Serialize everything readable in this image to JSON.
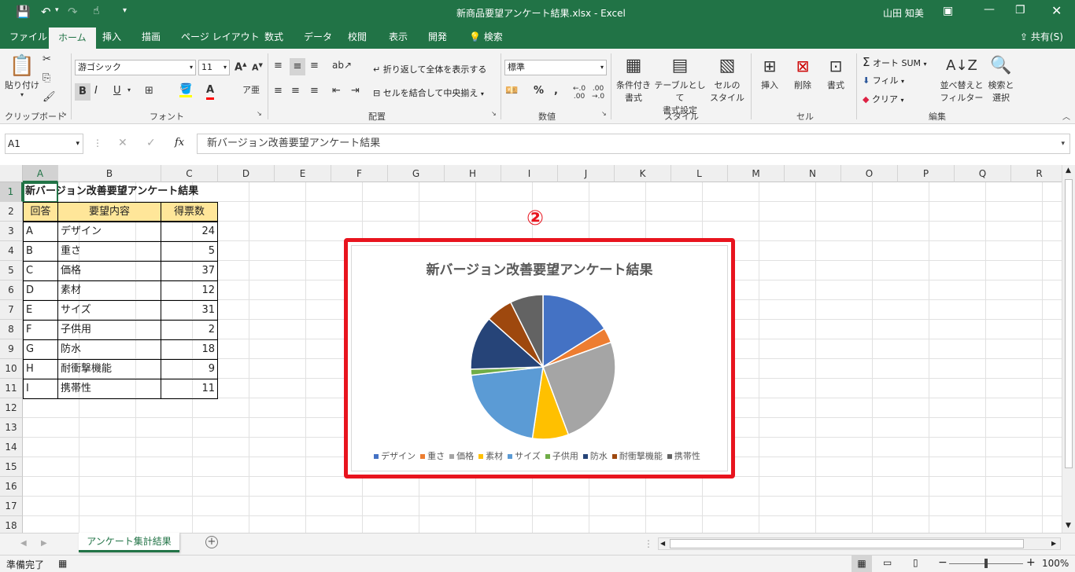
{
  "window": {
    "title": "新商品要望アンケート結果.xlsx  -  Excel",
    "user": "山田 知美"
  },
  "tabs": [
    "ファイル",
    "ホーム",
    "挿入",
    "描画",
    "ページ レイアウト",
    "数式",
    "データ",
    "校閲",
    "表示",
    "開発"
  ],
  "tell_me": "検索",
  "share": "共有(S)",
  "ribbon": {
    "clipboard": {
      "paste": "貼り付け",
      "group": "クリップボード"
    },
    "font": {
      "name": "游ゴシック",
      "size": "11",
      "group": "フォント"
    },
    "alignment": {
      "wrap": "折り返して全体を表示する",
      "merge": "セルを結合して中央揃え",
      "group": "配置"
    },
    "number": {
      "format": "標準",
      "group": "数値"
    },
    "styles": {
      "cond_line1": "条件付き",
      "cond_line2": "書式",
      "table_line1": "テーブルとして",
      "table_line2": "書式設定",
      "cell_line1": "セルの",
      "cell_line2": "スタイル",
      "group": "スタイル"
    },
    "cells": {
      "insert": "挿入",
      "delete": "削除",
      "format": "書式",
      "group": "セル"
    },
    "editing": {
      "autosum": "オート SUM",
      "fill": "フィル",
      "clear": "クリア",
      "sort_line1": "並べ替えと",
      "sort_line2": "フィルター",
      "find_line1": "検索と",
      "find_line2": "選択",
      "group": "編集"
    }
  },
  "formula_bar": {
    "name_box": "A1",
    "fx": "fx",
    "content": "新バージョン改善要望アンケート結果"
  },
  "columns": [
    "A",
    "B",
    "C",
    "D",
    "E",
    "F",
    "G",
    "H",
    "I",
    "J",
    "K",
    "L",
    "M",
    "N",
    "O",
    "P",
    "Q",
    "R"
  ],
  "rows": [
    "1",
    "2",
    "3",
    "4",
    "5",
    "6",
    "7",
    "8",
    "9",
    "10",
    "11",
    "12",
    "13",
    "14",
    "15",
    "16",
    "17",
    "18"
  ],
  "sheet": {
    "title": "新バージョン改善要望アンケート結果",
    "headers": [
      "回答",
      "要望内容",
      "得票数"
    ],
    "data": [
      [
        "A",
        "デザイン",
        "24"
      ],
      [
        "B",
        "重さ",
        "5"
      ],
      [
        "C",
        "価格",
        "37"
      ],
      [
        "D",
        "素材",
        "12"
      ],
      [
        "E",
        "サイズ",
        "31"
      ],
      [
        "F",
        "子供用",
        "2"
      ],
      [
        "G",
        "防水",
        "18"
      ],
      [
        "H",
        "耐衝撃機能",
        "9"
      ],
      [
        "I",
        "携帯性",
        "11"
      ]
    ]
  },
  "annotation": "②",
  "chart_data": {
    "type": "pie",
    "title": "新バージョン改善要望アンケート結果",
    "categories": [
      "デザイン",
      "重さ",
      "価格",
      "素材",
      "サイズ",
      "子供用",
      "防水",
      "耐衝撃機能",
      "携帯性"
    ],
    "values": [
      24,
      5,
      37,
      12,
      31,
      2,
      18,
      9,
      11
    ],
    "colors": [
      "#4472c4",
      "#ed7d31",
      "#a5a5a5",
      "#ffc000",
      "#5b9bd5",
      "#70ad47",
      "#264478",
      "#9e480e",
      "#636363"
    ],
    "legend": "bottom"
  },
  "sheet_tabs": [
    "アンケート集計結果"
  ],
  "status": {
    "ready": "準備完了",
    "zoom": "100%"
  },
  "colors": {
    "excel_green": "#217346",
    "highlight_red": "#e8141e",
    "header_fill": "#ffe699"
  }
}
